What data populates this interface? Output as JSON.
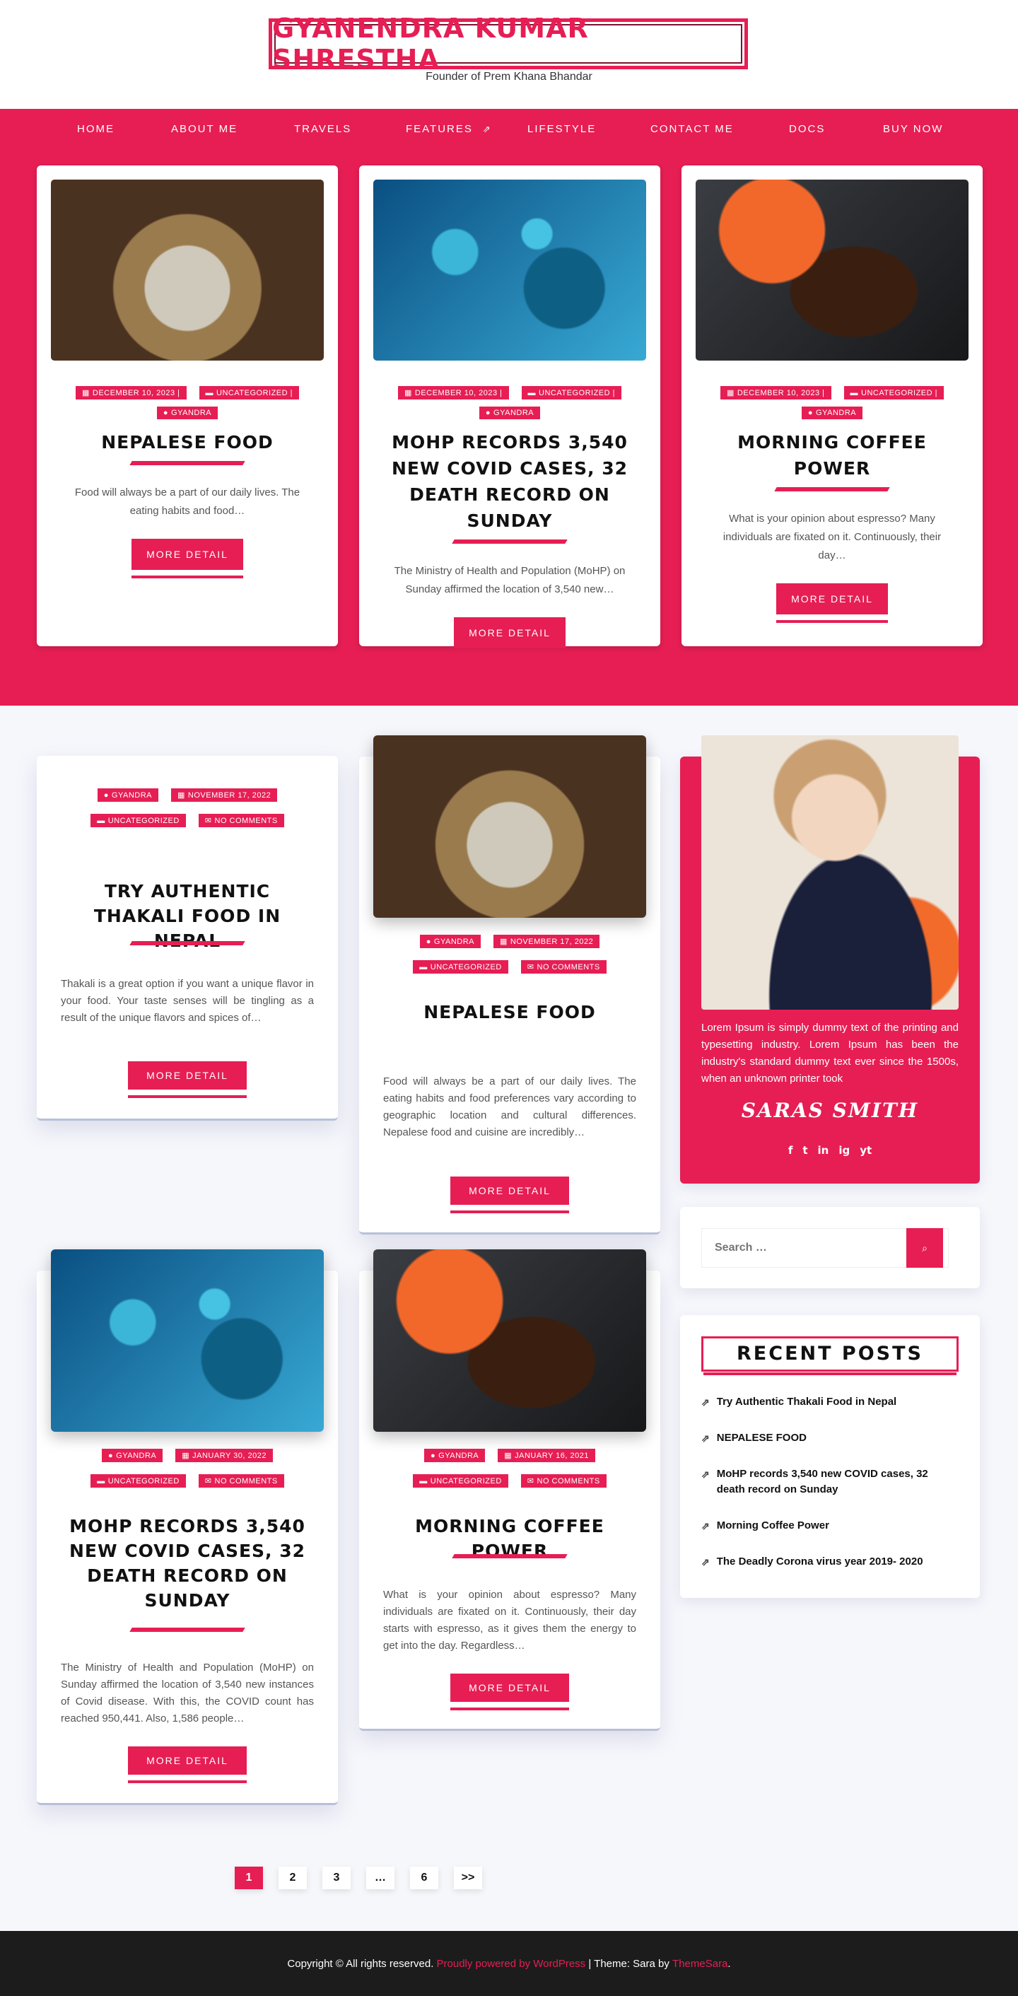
{
  "site": {
    "title": "GYANENDRA KUMAR SHRESTHA",
    "tagline": "Founder of Prem Khana Bhandar"
  },
  "nav": {
    "items": [
      "HOME",
      "ABOUT ME",
      "TRAVELS",
      "FEATURES",
      "LIFESTYLE",
      "CONTACT ME",
      "DOCS",
      "BUY NOW"
    ]
  },
  "featured": [
    {
      "date": "DECEMBER 10, 2023 |",
      "category": "UNCATEGORIZED |",
      "author": "GYANDRA",
      "title": "NEPALESE FOOD",
      "excerpt": "Food will always be a part of our daily lives. The eating habits and food…",
      "button": "MORE DETAIL"
    },
    {
      "date": "DECEMBER 10, 2023 |",
      "category": "UNCATEGORIZED |",
      "author": "GYANDRA",
      "title": "MOHP RECORDS 3,540 NEW COVID CASES, 32 DEATH RECORD ON SUNDAY",
      "excerpt": "The Ministry of Health and Population (MoHP) on Sunday affirmed the location of 3,540 new…",
      "button": "MORE DETAIL"
    },
    {
      "date": "DECEMBER 10, 2023 |",
      "category": "UNCATEGORIZED |",
      "author": "GYANDRA",
      "title": "MORNING COFFEE POWER",
      "excerpt": "What is your opinion about espresso? Many individuals are fixated on it. Continuously, their day…",
      "button": "MORE DETAIL"
    }
  ],
  "posts": [
    {
      "author": "GYANDRA",
      "date": "NOVEMBER 17, 2022",
      "category": "UNCATEGORIZED",
      "comments": "NO COMMENTS",
      "title": "TRY AUTHENTIC THAKALI FOOD IN NEPAL",
      "excerpt": "Thakali is a great option if you want a unique flavor in your food. Your taste senses will be tingling as a result of the unique flavors and spices of…",
      "button": "MORE DETAIL"
    },
    {
      "author": "GYANDRA",
      "date": "NOVEMBER 17, 2022",
      "category": "UNCATEGORIZED",
      "comments": "NO COMMENTS",
      "title": "NEPALESE FOOD",
      "excerpt": "Food will always be a part of our daily lives. The eating habits and food preferences vary according to geographic location and cultural differences. Nepalese food and cuisine are incredibly…",
      "button": "MORE DETAIL"
    },
    {
      "author": "GYANDRA",
      "date": "JANUARY 30, 2022",
      "category": "UNCATEGORIZED",
      "comments": "NO COMMENTS",
      "title": "MOHP RECORDS 3,540 NEW COVID CASES, 32 DEATH RECORD ON SUNDAY",
      "excerpt": "The Ministry of Health and Population (MoHP) on Sunday affirmed the location of 3,540 new instances of Covid disease. With this, the COVID count has reached 950,441. Also, 1,586 people…",
      "button": "MORE DETAIL"
    },
    {
      "author": "GYANDRA",
      "date": "JANUARY 16, 2021",
      "category": "UNCATEGORIZED",
      "comments": "NO COMMENTS",
      "title": "MORNING COFFEE POWER",
      "excerpt": "What is your opinion about espresso? Many individuals are fixated on it. Continuously, their day starts with espresso, as it gives them the energy to get into the day. Regardless…",
      "button": "MORE DETAIL"
    }
  ],
  "sidebar": {
    "author": {
      "bio": "Lorem Ipsum is simply dummy text of the printing and typesetting industry. Lorem Ipsum has been the industry's standard dummy text ever since the 1500s, when an unknown printer took",
      "name": "SARAS SMITH",
      "social": [
        "f",
        "t",
        "in",
        "ig",
        "yt"
      ]
    },
    "search": {
      "placeholder": "Search …"
    },
    "recent": {
      "title": "RECENT POSTS",
      "items": [
        "Try Authentic Thakali Food in Nepal",
        "NEPALESE FOOD",
        "MoHP records 3,540 new COVID cases, 32 death record on Sunday",
        "Morning Coffee Power",
        "The Deadly Corona virus year 2019- 2020"
      ]
    }
  },
  "pagination": {
    "pages": [
      "1",
      "2",
      "3",
      "…",
      "6",
      ">>"
    ],
    "current": "1"
  },
  "footer": {
    "copyright": "Copyright © All rights reserved.",
    "powered": "Proudly powered by WordPress",
    "theme_prefix": "| Theme: Sara by",
    "theme_link": "ThemeSara",
    "suffix": "."
  },
  "colors": {
    "accent": "#e61e54",
    "footer": "#1c1c1c"
  },
  "icons": {
    "date": "calendar-icon",
    "category": "folder-icon",
    "author": "user-icon",
    "comments": "comment-icon",
    "submenu": "submenu-icon",
    "search": "search-icon",
    "recent": "share-icon"
  }
}
